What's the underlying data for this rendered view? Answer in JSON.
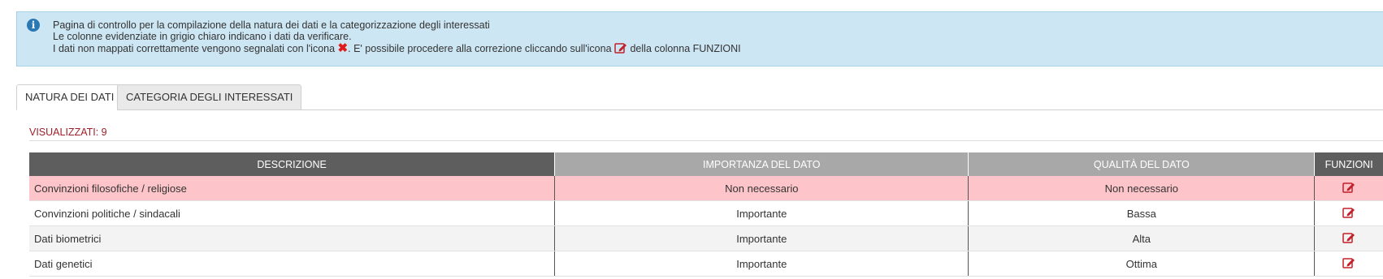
{
  "info": {
    "line1": "Pagina di controllo per la compilazione della natura dei dati e la categorizzazione degli interessati",
    "line2": "Le colonne evidenziate in grigio chiaro indicano i dati da verificare.",
    "line3_a": "I dati non mappati correttamente vengono segnalati con l'icona",
    "line3_b": ". E' possibile procedere alla correzione cliccando sull'icona",
    "line3_c": "della colonna FUNZIONI"
  },
  "tabs": [
    {
      "label": "NATURA DEI DATI"
    },
    {
      "label": "CATEGORIA DEGLI INTERESSATI"
    }
  ],
  "counter": "VISUALIZZATI: 9",
  "table": {
    "headers": {
      "descrizione": "DESCRIZIONE",
      "importanza": "IMPORTANZA DEL DATO",
      "qualita": "QUALITÀ DEL DATO",
      "funzioni": "FUNZIONI"
    },
    "rows": [
      {
        "descrizione": "Convinzioni filosofiche / religiose",
        "importanza": "Non necessario",
        "qualita": "Non necessario",
        "error": true
      },
      {
        "descrizione": "Convinzioni politiche / sindacali",
        "importanza": "Importante",
        "qualita": "Bassa",
        "error": false
      },
      {
        "descrizione": "Dati biometrici",
        "importanza": "Importante",
        "qualita": "Alta",
        "error": false
      },
      {
        "descrizione": "Dati genetici",
        "importanza": "Importante",
        "qualita": "Ottima",
        "error": false
      }
    ]
  },
  "colors": {
    "error_row": "#fdc5c9",
    "edit_icon": "#c2202a",
    "error_x": "#e01b1b",
    "counter": "#a0202a"
  },
  "icons": {
    "info": "info-circle-icon",
    "error": "x-mark-icon",
    "edit": "edit-pencil-icon"
  }
}
